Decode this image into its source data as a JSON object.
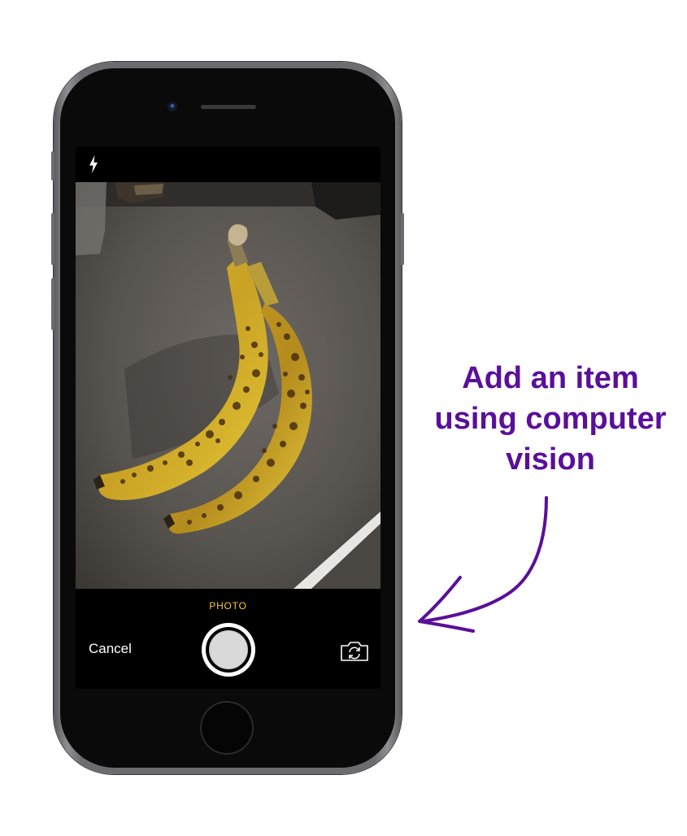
{
  "screen": {
    "mode_label": "PHOTO",
    "cancel_label": "Cancel",
    "flash_icon": "flash-icon",
    "switch_camera_icon": "switch-camera-icon",
    "shutter_icon": "shutter-button"
  },
  "annotation": {
    "line1": "Add an item",
    "line2": "using computer",
    "line3": "vision",
    "color": "#5a0f9a"
  },
  "colors": {
    "mode_label": "#f7c543",
    "screen_bg": "#000000",
    "phone_frame": "#6b6b70"
  }
}
